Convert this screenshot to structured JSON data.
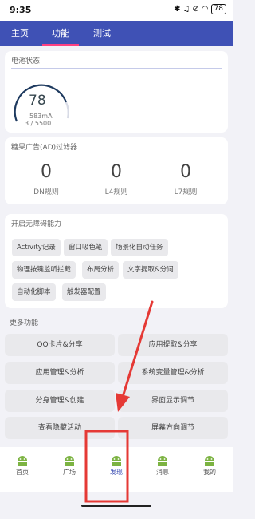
{
  "status_bar": {
    "time": "9:35",
    "icons": [
      "bluetooth-icon",
      "headphones-icon",
      "mute-icon",
      "wifi-icon",
      "battery-icon"
    ],
    "battery": "78"
  },
  "tabs": [
    {
      "label": "主页"
    },
    {
      "label": "功能"
    },
    {
      "label": "测试"
    }
  ],
  "tabbar_color": "#3f51b5",
  "battery_card": {
    "title": "电池状态",
    "level": "78",
    "current": "583mA",
    "capacity": "3 / 5500",
    "gauge_fraction": 0.78
  },
  "ad_card": {
    "title": "糖果广告(AD)过滤器",
    "stats": [
      {
        "value": "0",
        "label": "DN规则"
      },
      {
        "value": "0",
        "label": "L4规则"
      },
      {
        "value": "0",
        "label": "L7规则"
      }
    ]
  },
  "accessibility": {
    "title": "开启无障碍能力",
    "chips": [
      "Activity记录",
      "窗口吸色笔",
      "场景化自动任务",
      "物理按键监听拦截",
      "布局分析",
      "文字提取&分词",
      "自动化脚本",
      "触发器配置"
    ]
  },
  "more": {
    "title": "更多功能",
    "buttons": [
      "QQ卡片&分享",
      "应用提取&分享",
      "应用管理&分析",
      "系统变量管理&分析",
      "分身管理&创建",
      "界面显示调节",
      "查看隐藏活动",
      "屏幕方向调节"
    ]
  },
  "bottom_nav": [
    {
      "label": "首页"
    },
    {
      "label": "广场"
    },
    {
      "label": "发现"
    },
    {
      "label": "消息"
    },
    {
      "label": "我的"
    }
  ],
  "colors": {
    "accent": "#ff4081",
    "android_green": "#7cb342",
    "annotation_red": "#e53935"
  }
}
